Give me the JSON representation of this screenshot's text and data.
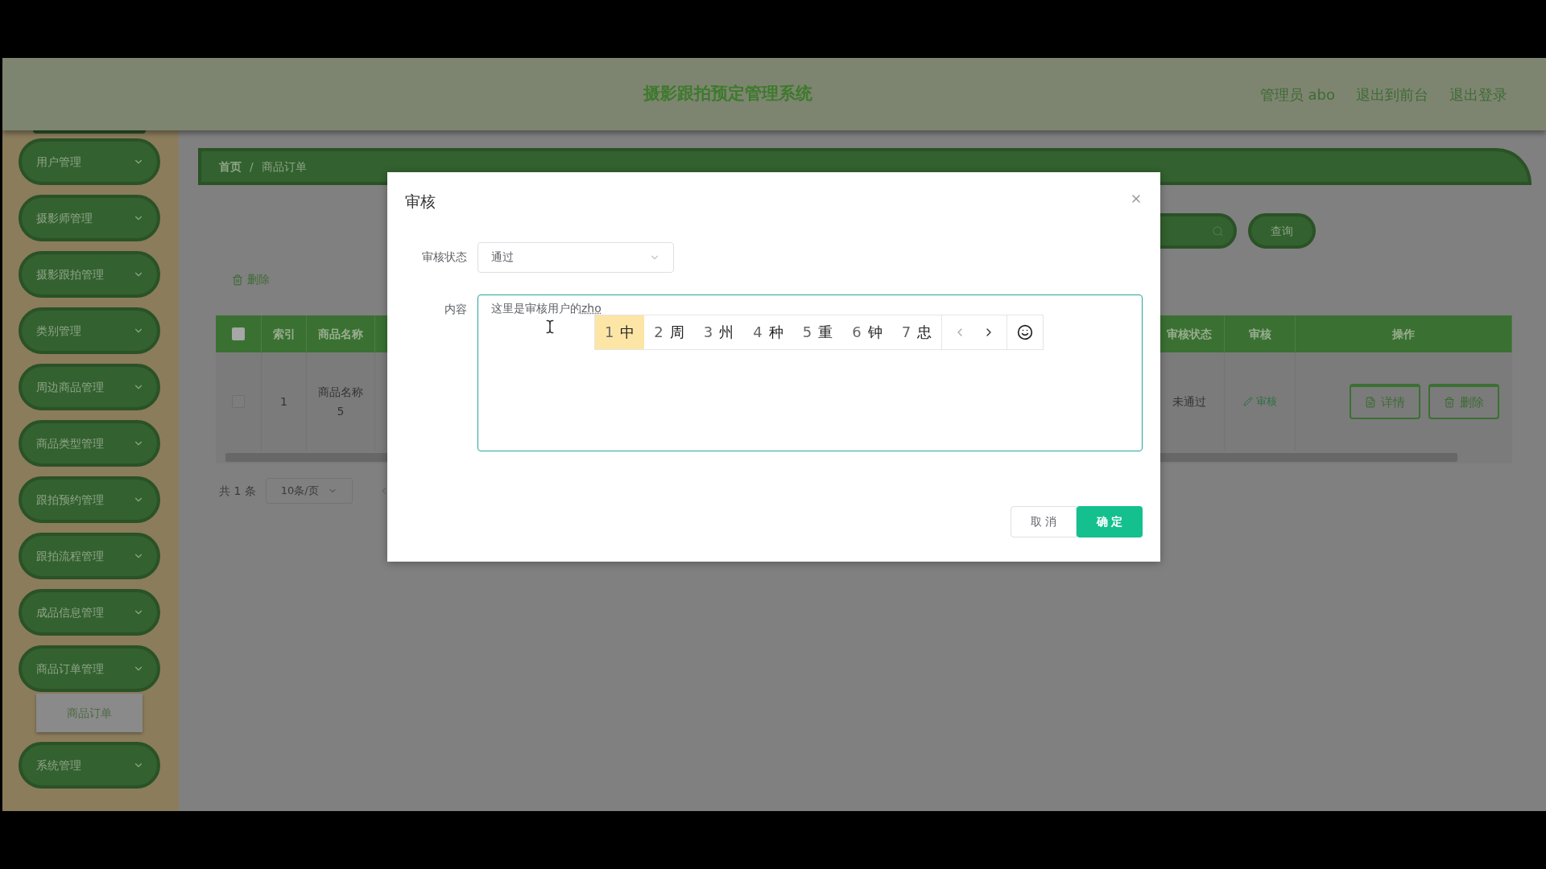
{
  "header": {
    "title": "摄影跟拍预定管理系统",
    "user": "管理员 abo",
    "links": [
      "退出到前台",
      "退出登录"
    ]
  },
  "sidebar": {
    "items": [
      {
        "label": "用户管理"
      },
      {
        "label": "摄影师管理"
      },
      {
        "label": "摄影跟拍管理"
      },
      {
        "label": "类别管理"
      },
      {
        "label": "周边商品管理"
      },
      {
        "label": "商品类型管理"
      },
      {
        "label": "跟拍预约管理"
      },
      {
        "label": "跟拍流程管理"
      },
      {
        "label": "成品信息管理"
      },
      {
        "label": "商品订单管理",
        "children": [
          {
            "label": "商品订单"
          }
        ]
      },
      {
        "label": "系统管理"
      }
    ]
  },
  "breadcrumb": {
    "items": [
      "首页",
      "商品订单"
    ],
    "separator": "/"
  },
  "search": {
    "button": "查询"
  },
  "toolbar": {
    "delete": "删除"
  },
  "table": {
    "header_checkbox": {
      "checked": false
    },
    "columns_left": [
      "索引",
      "商品名称"
    ],
    "columns_right": [
      "审核状态",
      "审核",
      "操作"
    ],
    "rows": [
      {
        "checked": false,
        "index": "1",
        "name": "商品名称5",
        "status": "未通过",
        "audit": "审核",
        "actions": [
          "详情",
          "删除"
        ]
      }
    ]
  },
  "pagination": {
    "total": "共 1 条",
    "page_size": "10条/页"
  },
  "dialog": {
    "title": "审核",
    "status_field": {
      "label": "审核状态",
      "value": "通过"
    },
    "content_field": {
      "label": "内容",
      "value": "这里是审核用户的",
      "composition": "zho"
    },
    "ime_candidates": [
      {
        "number": "1",
        "char": "中",
        "selected": true
      },
      {
        "number": "2",
        "char": "周",
        "selected": false
      },
      {
        "number": "3",
        "char": "州",
        "selected": false
      },
      {
        "number": "4",
        "char": "种",
        "selected": false
      },
      {
        "number": "5",
        "char": "重",
        "selected": false
      },
      {
        "number": "6",
        "char": "钟",
        "selected": false
      },
      {
        "number": "7",
        "char": "忠",
        "selected": false
      }
    ],
    "buttons": {
      "cancel": "取 消",
      "confirm": "确 定"
    }
  }
}
